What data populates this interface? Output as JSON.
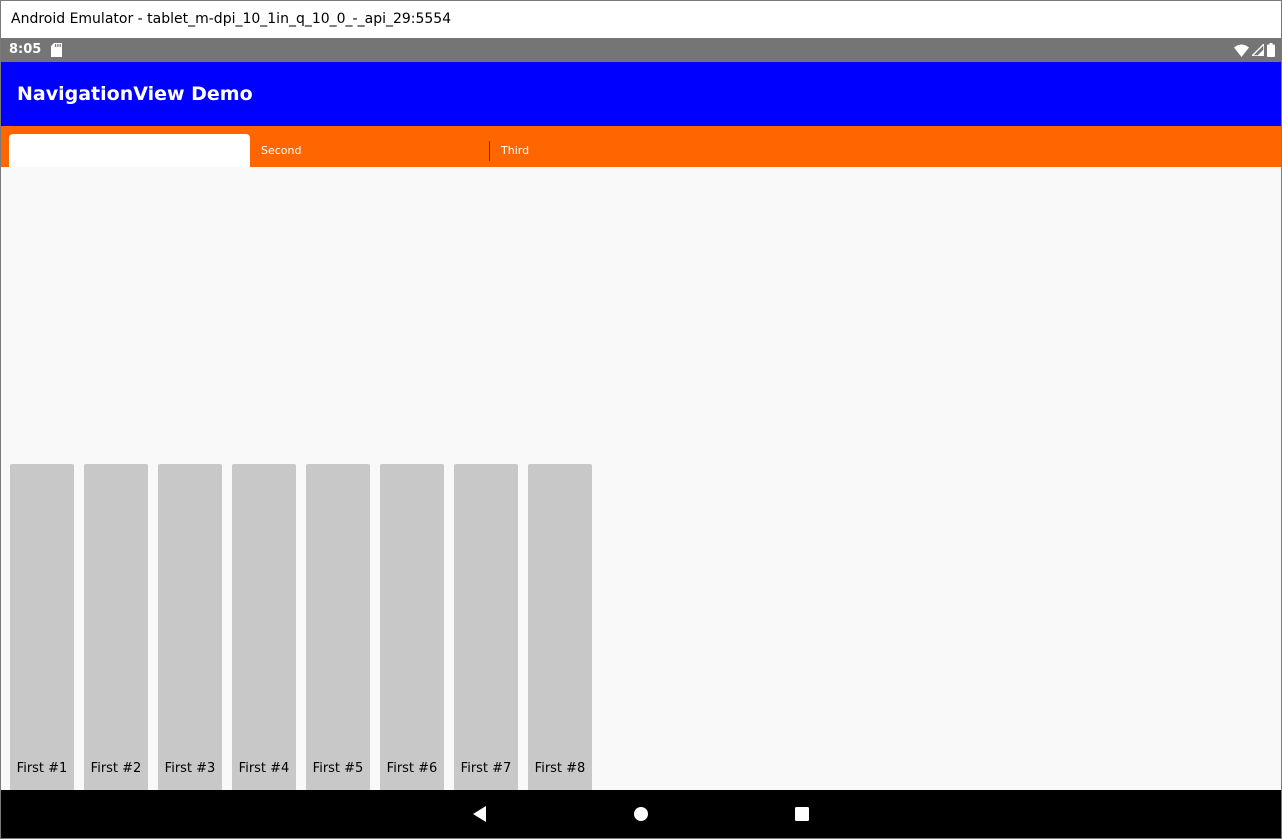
{
  "window": {
    "title": "Android Emulator - tablet_m-dpi_10_1in_q_10_0_-_api_29:5554"
  },
  "status_bar": {
    "time": "8:05",
    "icons": [
      "sd-card-icon",
      "wifi-icon",
      "signal-icon",
      "battery-icon"
    ]
  },
  "app_bar": {
    "title": "NavigationView Demo",
    "color": "#0000ff"
  },
  "tabs": {
    "color": "#ff6600",
    "items": [
      {
        "label": "",
        "selected": true
      },
      {
        "label": "Second",
        "selected": false
      },
      {
        "label": "Third",
        "selected": false
      }
    ]
  },
  "cards": [
    {
      "label": "First #1"
    },
    {
      "label": "First #2"
    },
    {
      "label": "First #3"
    },
    {
      "label": "First #4"
    },
    {
      "label": "First #5"
    },
    {
      "label": "First #6"
    },
    {
      "label": "First #7"
    },
    {
      "label": "First #8"
    }
  ],
  "nav_bar": {
    "buttons": [
      "back-icon",
      "home-icon",
      "recents-icon"
    ]
  }
}
